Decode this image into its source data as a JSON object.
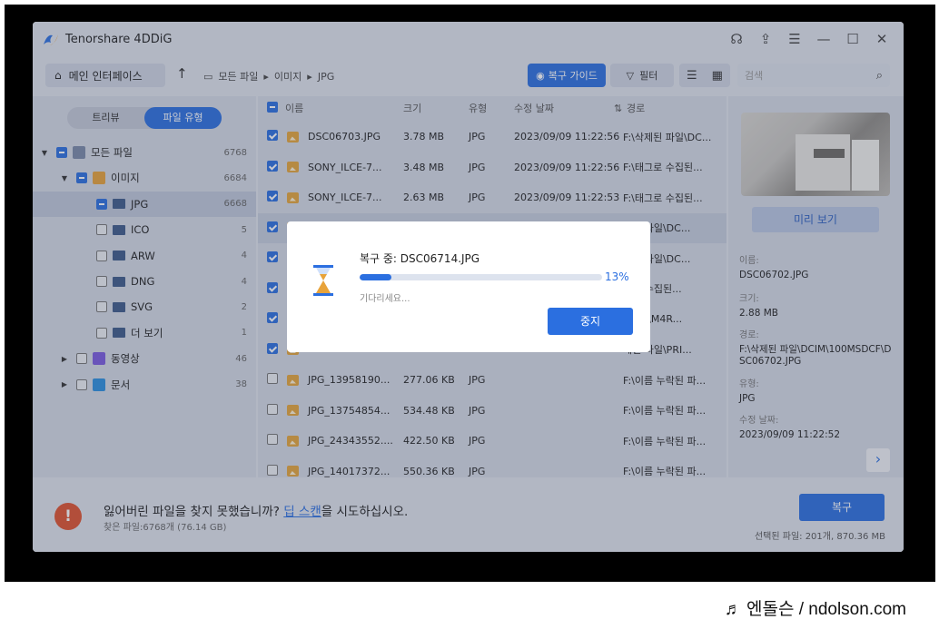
{
  "app": {
    "title": "Tenorshare 4DDiG"
  },
  "toolbar": {
    "home_label": "메인 인터페이스",
    "breadcrumb": [
      "모든 파일",
      "이미지",
      "JPG"
    ],
    "guide_label": "복구 가이드",
    "filter_label": "필터",
    "search_placeholder": "검색"
  },
  "sidebar": {
    "tabs": [
      "트리뷰",
      "파일 유형"
    ],
    "active_tab": "파일 유형",
    "tree": [
      {
        "label": "모든 파일",
        "count": "6768",
        "level": 0,
        "expanded": true,
        "check": "partial"
      },
      {
        "label": "이미지",
        "count": "6684",
        "level": 1,
        "expanded": true,
        "check": "partial"
      },
      {
        "label": "JPG",
        "count": "6668",
        "level": 2,
        "check": "partial",
        "selected": true
      },
      {
        "label": "ICO",
        "count": "5",
        "level": 2,
        "check": "none"
      },
      {
        "label": "ARW",
        "count": "4",
        "level": 2,
        "check": "none"
      },
      {
        "label": "DNG",
        "count": "4",
        "level": 2,
        "check": "none"
      },
      {
        "label": "SVG",
        "count": "2",
        "level": 2,
        "check": "none"
      },
      {
        "label": "더 보기",
        "count": "1",
        "level": 2,
        "check": "none"
      },
      {
        "label": "동영상",
        "count": "46",
        "level": 1,
        "expanded": false,
        "check": "none"
      },
      {
        "label": "문서",
        "count": "38",
        "level": 1,
        "expanded": false,
        "check": "none"
      }
    ]
  },
  "filelist": {
    "headers": [
      "이름",
      "크기",
      "유형",
      "수정 날짜",
      "경로"
    ],
    "rows": [
      {
        "name": "DSC06703.JPG",
        "size": "3.78 MB",
        "type": "JPG",
        "date": "2023/09/09 11:22:56",
        "path": "F:\\삭제된 파일\\DC...",
        "checked": true
      },
      {
        "name": "SONY_ILCE-7...",
        "size": "3.48 MB",
        "type": "JPG",
        "date": "2023/09/09 11:22:56",
        "path": "F:\\태그로 수집된...",
        "checked": true
      },
      {
        "name": "SONY_ILCE-7...",
        "size": "2.63 MB",
        "type": "JPG",
        "date": "2023/09/09 11:22:53",
        "path": "F:\\태그로 수집된...",
        "checked": true
      },
      {
        "name": "",
        "size": "",
        "type": "",
        "date": "",
        "path": "제된 파일\\DC...",
        "checked": true
      },
      {
        "name": "",
        "size": "",
        "type": "",
        "date": "",
        "path": "제된 파일\\DC...",
        "checked": true
      },
      {
        "name": "",
        "size": "",
        "type": "",
        "date": "",
        "path": "그로 수집된...",
        "checked": true
      },
      {
        "name": "",
        "size": "",
        "type": "",
        "date": "",
        "path": "VATE\\M4R...",
        "checked": true
      },
      {
        "name": "",
        "size": "",
        "type": "",
        "date": "",
        "path": "제된 파일\\PRI...",
        "checked": true
      },
      {
        "name": "JPG_13958190...",
        "size": "277.06 KB",
        "type": "JPG",
        "date": "",
        "path": "F:\\이름 누락된 파...",
        "checked": false
      },
      {
        "name": "JPG_13754854...",
        "size": "534.48 KB",
        "type": "JPG",
        "date": "",
        "path": "F:\\이름 누락된 파...",
        "checked": false
      },
      {
        "name": "JPG_24343552....",
        "size": "422.50 KB",
        "type": "JPG",
        "date": "",
        "path": "F:\\이름 누락된 파...",
        "checked": false
      },
      {
        "name": "JPG_14017372...",
        "size": "550.36 KB",
        "type": "JPG",
        "date": "",
        "path": "F:\\이름 누락된 파...",
        "checked": false
      }
    ]
  },
  "preview": {
    "button": "미리 보기",
    "name_label": "이름:",
    "name": "DSC06702.JPG",
    "size_label": "크기:",
    "size": "2.88 MB",
    "path_label": "경로:",
    "path": "F:\\삭제된 파일\\DCIM\\100MSDCF\\DSC06702.JPG",
    "type_label": "유형:",
    "type": "JPG",
    "date_label": "수정 날짜:",
    "date": "2023/09/09 11:22:52"
  },
  "bottom": {
    "msg_prefix": "잃어버린 파일을 찾지 못했습니까?",
    "msg_link": "딥 스캔",
    "msg_suffix": "을 시도하십시오.",
    "found": "찾은 파일:6768개 (76.14 GB)",
    "recover": "복구",
    "selected": "선택된 파일: 201개, 870.36 MB"
  },
  "dialog": {
    "title": "복구 중: DSC06714.JPG",
    "progress": 0.13,
    "percent": "13%",
    "wait": "기다리세요...",
    "stop": "중지"
  },
  "watermark": "♬ 엔돌슨 / ndolson.com",
  "colors": {
    "accent": "#2b6fe0",
    "warning": "#e0532f"
  }
}
